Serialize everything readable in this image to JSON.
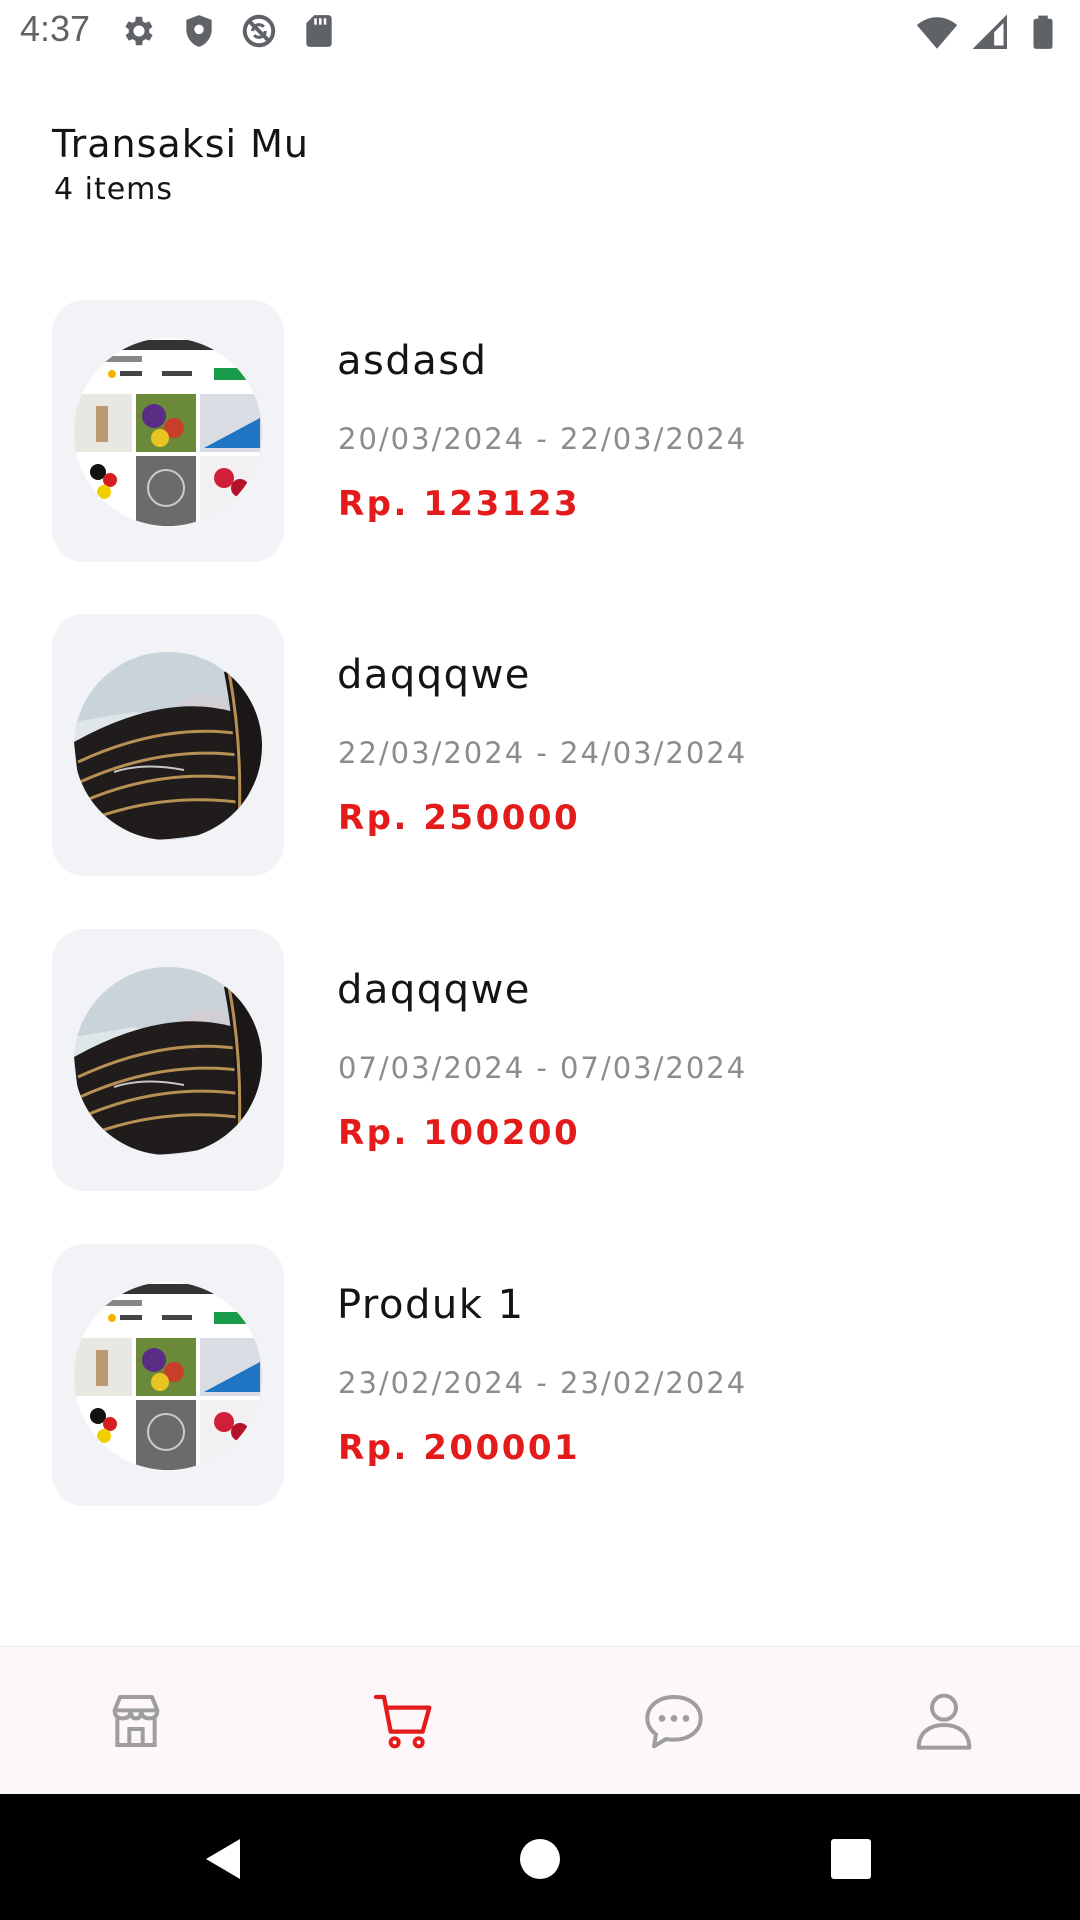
{
  "status_bar": {
    "time": "4:37",
    "left_icons": [
      "settings-icon",
      "shield-icon",
      "no-sync-icon",
      "sd-card-icon"
    ],
    "right_icons": [
      "wifi-icon",
      "cell-signal-icon",
      "battery-icon"
    ]
  },
  "header": {
    "title": "Transaksi Mu",
    "count": "4 items"
  },
  "transactions": [
    {
      "name": "asdasd",
      "dates": "20/03/2024 - 22/03/2024",
      "price": "Rp. 123123",
      "image": "store-collage"
    },
    {
      "name": "daqqqwe",
      "dates": "22/03/2024 - 24/03/2024",
      "price": "Rp. 250000",
      "image": "drum-photo"
    },
    {
      "name": "daqqqwe",
      "dates": "07/03/2024 - 07/03/2024",
      "price": "Rp. 100200",
      "image": "drum-photo"
    },
    {
      "name": "Produk 1",
      "dates": "23/02/2024 - 23/02/2024",
      "price": "Rp. 200001",
      "image": "store-collage"
    }
  ],
  "bottom_nav": {
    "items": [
      {
        "icon": "store-icon",
        "active": false
      },
      {
        "icon": "cart-icon",
        "active": true
      },
      {
        "icon": "chat-icon",
        "active": false
      },
      {
        "icon": "profile-icon",
        "active": false
      }
    ]
  },
  "colors": {
    "accent": "#e31b1b",
    "muted_text": "#8c8c8c",
    "nav_inactive": "#9e9e9e",
    "card_bg": "#f2f3f7",
    "nav_bg": "#fdf7fa"
  }
}
